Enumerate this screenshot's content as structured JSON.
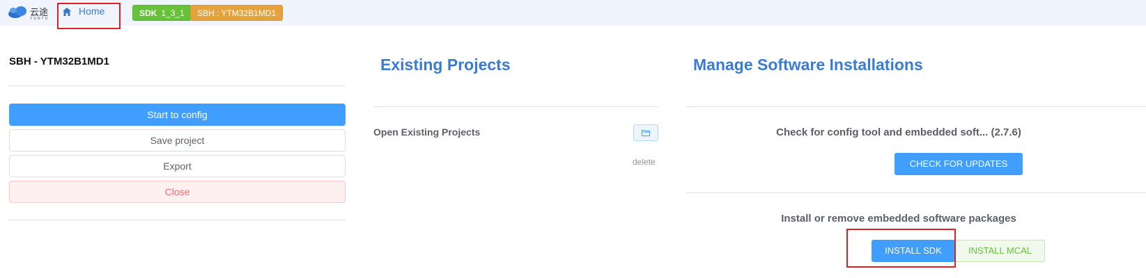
{
  "header": {
    "logo_text": "云途",
    "logo_sub": "YUNTU",
    "home_label": "Home",
    "sdk_tag_prefix": "SDK",
    "sdk_tag_version": "1_3_1",
    "sbh_tag": "SBH : YTM32B1MD1"
  },
  "left_panel": {
    "title": "SBH - YTM32B1MD1",
    "buttons": {
      "start_config": "Start to config",
      "save_project": "Save project",
      "export": "Export",
      "close": "Close"
    }
  },
  "middle_panel": {
    "title": "Existing Projects",
    "open_label": "Open Existing Projects",
    "delete_label": "delete"
  },
  "right_panel": {
    "title": "Manage Software Installations",
    "check_label": "Check for config tool and embedded soft... (2.7.6)",
    "check_button": "CHECK FOR UPDATES",
    "install_label": "Install or remove embedded software packages",
    "install_sdk_button": "INSTALL SDK",
    "install_mcal_button": "INSTALL MCAL"
  },
  "colors": {
    "primary": "#409eff",
    "title_blue": "#3a7bd5",
    "success": "#67c23a",
    "warning": "#e6a23c",
    "danger": "#f56c6c",
    "highlight_red": "#e02020"
  }
}
